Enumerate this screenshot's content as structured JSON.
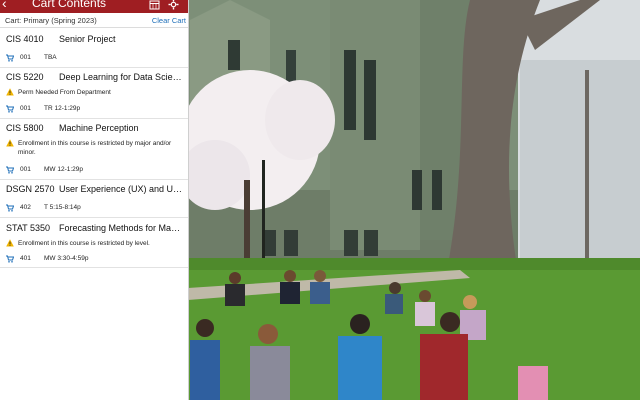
{
  "header": {
    "back_glyph": "‹",
    "title": "Cart Contents",
    "icons": [
      "calendar-icon",
      "settings-icon"
    ]
  },
  "cart": {
    "label": "Cart: Primary (Spring 2023)",
    "clear_label": "Clear Cart"
  },
  "courses": [
    {
      "code": "CIS 4010",
      "name": "Senior Project",
      "warning": "",
      "section": "001",
      "time": "TBA"
    },
    {
      "code": "CIS 5220",
      "name": "Deep Learning for Data Science",
      "warning": "Perm Needed From Department",
      "section": "001",
      "time": "TR 12-1:29p"
    },
    {
      "code": "CIS 5800",
      "name": "Machine Perception",
      "warning": "Enrollment in this course is restricted by major and/or minor.",
      "section": "001",
      "time": "MW 12-1:29p"
    },
    {
      "code": "DSGN 2570",
      "name": "User Experience (UX) and Us...",
      "warning": "",
      "section": "402",
      "time": "T 5:15-8:14p"
    },
    {
      "code": "STAT 5350",
      "name": "Forecasting Methods for Man...",
      "warning": "Enrollment in this course is restricted by level.",
      "section": "401",
      "time": "MW 3:30-4:59p"
    }
  ],
  "colors": {
    "header_red": "#9f1e22",
    "link_blue": "#1f6fb8",
    "cart_icon_blue": "#1f6fb8",
    "warning_yellow": "#f0b400"
  }
}
